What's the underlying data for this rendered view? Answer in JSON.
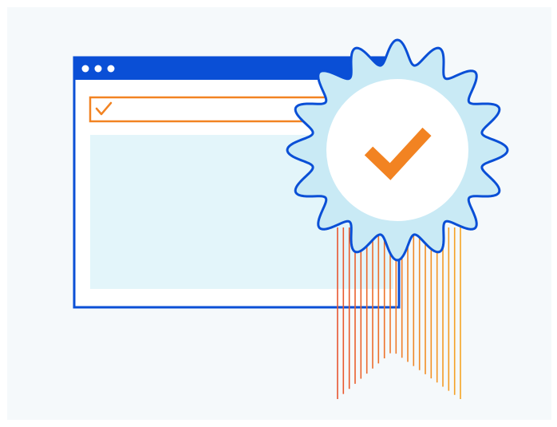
{
  "illustration": {
    "browser_window": {
      "titlebar_dots": 3,
      "address_bar_icon": "check-icon",
      "content_placeholder": true
    },
    "badge": {
      "icon": "checkmark-icon",
      "shape": "scalloped-seal",
      "ribbon": "striped-orange"
    }
  },
  "colors": {
    "background": "#f5f9fb",
    "primary_blue": "#0a4fd6",
    "light_blue": "#c9eaf5",
    "pale_blue": "#e3f5fa",
    "accent_orange": "#f28322",
    "accent_red_orange": "#e8552f",
    "white": "#ffffff"
  }
}
